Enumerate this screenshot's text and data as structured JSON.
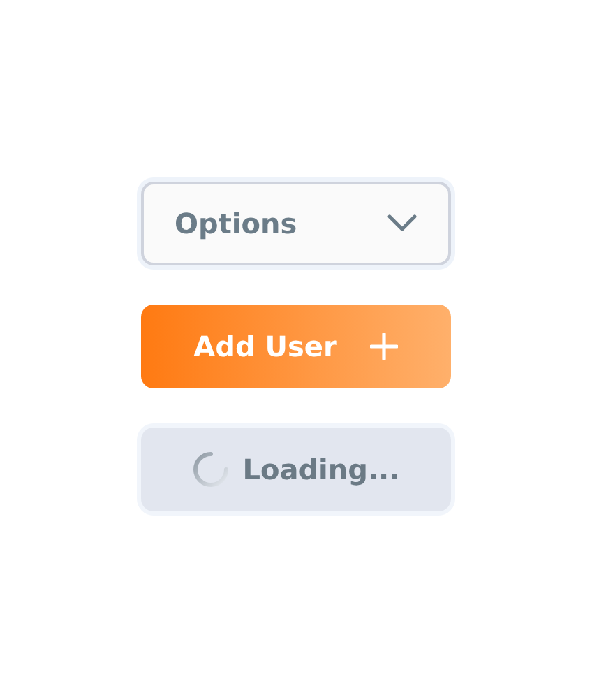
{
  "buttons": [
    {
      "kind": "dropdown",
      "label": "Options"
    },
    {
      "kind": "primary",
      "label": "Add User"
    },
    {
      "kind": "loading",
      "label": "Loading..."
    }
  ]
}
